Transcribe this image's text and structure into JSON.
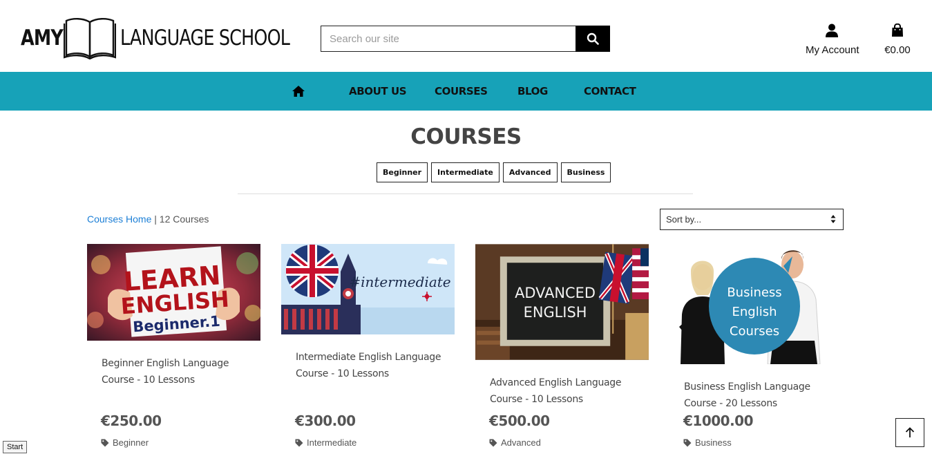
{
  "brand": {
    "word1": "AMY",
    "word2": "LANGUAGE SCHOOL"
  },
  "search": {
    "placeholder": "Search our site"
  },
  "header": {
    "account_label": "My Account",
    "cart_total": "€0.00"
  },
  "nav": {
    "items": [
      "ABOUT US",
      "COURSES",
      "BLOG",
      "CONTACT"
    ]
  },
  "page": {
    "title": "COURSES"
  },
  "filters": [
    "Beginner",
    "Intermediate",
    "Advanced",
    "Business"
  ],
  "breadcrumb": {
    "link": "Courses Home",
    "separator": "|",
    "count": "12 Courses"
  },
  "sort": {
    "selected": "Sort by..."
  },
  "courses": [
    {
      "title": "Beginner English Language Course - 10 Lessons",
      "price": "€250.00",
      "category": "Beginner",
      "image_text": [
        "LEARN",
        "ENGLISH",
        "Beginner.1"
      ]
    },
    {
      "title": "Intermediate English Language Course - 10 Lessons",
      "price": "€300.00",
      "category": "Intermediate",
      "image_text": [
        "#intermediate"
      ]
    },
    {
      "title": "Advanced English Language Course - 10 Lessons",
      "price": "€500.00",
      "category": "Advanced",
      "image_text": [
        "ADVANCED",
        "ENGLISH"
      ]
    },
    {
      "title": "Business English Language Course - 20 Lessons",
      "price": "€1000.00",
      "category": "Business",
      "image_text": [
        "Business",
        "English",
        "Courses"
      ]
    }
  ],
  "footer": {
    "start_label": "Start"
  },
  "colors": {
    "nav_bg": "#17a2b8",
    "link": "#1c7fd6",
    "text": "#444444"
  },
  "icons": {
    "search": "search-icon",
    "account": "user-icon",
    "cart": "shopping-bag-icon",
    "home": "home-icon",
    "tag": "tag-icon",
    "back_to_top": "arrow-up-icon",
    "sort": "sort-arrows-icon"
  }
}
